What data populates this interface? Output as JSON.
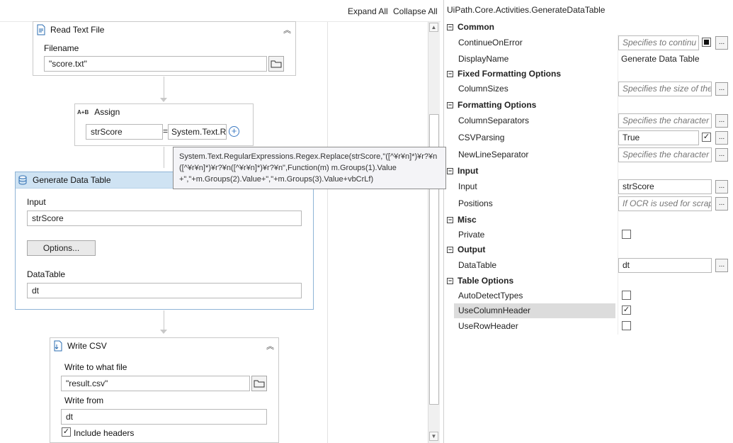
{
  "toolbar": {
    "expand_all": "Expand All",
    "collapse_all": "Collapse All"
  },
  "read_text_file": {
    "title": "Read Text File",
    "filename_label": "Filename",
    "filename_value": "\"score.txt\""
  },
  "assign": {
    "title": "Assign",
    "icon_text": "A+B",
    "to": "strScore",
    "eq": "=",
    "value": "System.Text.Re"
  },
  "tooltip": {
    "line1": "System.Text.RegularExpressions.Regex.Replace(strScore,\"([^¥r¥n]*)¥r?¥n",
    "line2": "([^¥r¥n]*)¥r?¥n([^¥r¥n]*)¥r?¥n\",Function(m) m.Groups(1).Value",
    "line3": "+\",\"+m.Groups(2).Value+\",\"+m.Groups(3).Value+vbCrLf)"
  },
  "generate_data_table": {
    "title": "Generate Data Table",
    "input_label": "Input",
    "input_value": "strScore",
    "options_button": "Options...",
    "datatable_label": "DataTable",
    "datatable_value": "dt"
  },
  "write_csv": {
    "title": "Write CSV",
    "file_label": "Write to what file",
    "file_value": "\"result.csv\"",
    "from_label": "Write from",
    "from_value": "dt",
    "include_headers_label": "Include headers",
    "include_headers_checked": true
  },
  "properties": {
    "title": "UiPath.Core.Activities.GenerateDataTable",
    "categories": {
      "common": "Common",
      "fixed": "Fixed Formatting Options",
      "formatting": "Formatting Options",
      "input": "Input",
      "misc": "Misc",
      "output": "Output",
      "table": "Table Options"
    },
    "rows": {
      "continue_on_error": {
        "name": "ContinueOnError",
        "placeholder": "Specifies to continu"
      },
      "display_name": {
        "name": "DisplayName",
        "value": "Generate Data Table"
      },
      "column_sizes": {
        "name": "ColumnSizes",
        "placeholder": "Specifies the size of the"
      },
      "column_separators": {
        "name": "ColumnSeparators",
        "placeholder": "Specifies the character u"
      },
      "csv_parsing": {
        "name": "CSVParsing",
        "value": "True",
        "checked": true
      },
      "newline_separator": {
        "name": "NewLineSeparator",
        "placeholder": "Specifies the character u"
      },
      "input": {
        "name": "Input",
        "value": "strScore"
      },
      "positions": {
        "name": "Positions",
        "placeholder": "If OCR is used for scrapi"
      },
      "private": {
        "name": "Private",
        "checked": false
      },
      "datatable": {
        "name": "DataTable",
        "value": "dt"
      },
      "auto_detect_types": {
        "name": "AutoDetectTypes",
        "checked": false
      },
      "use_column_header": {
        "name": "UseColumnHeader",
        "checked": true
      },
      "use_row_header": {
        "name": "UseRowHeader",
        "checked": false
      }
    },
    "ellipsis": "..."
  },
  "colors": {
    "selected_header": "#cfe3f3",
    "selected_border": "#8fb4d6",
    "row_highlight": "#dcdcdc"
  }
}
